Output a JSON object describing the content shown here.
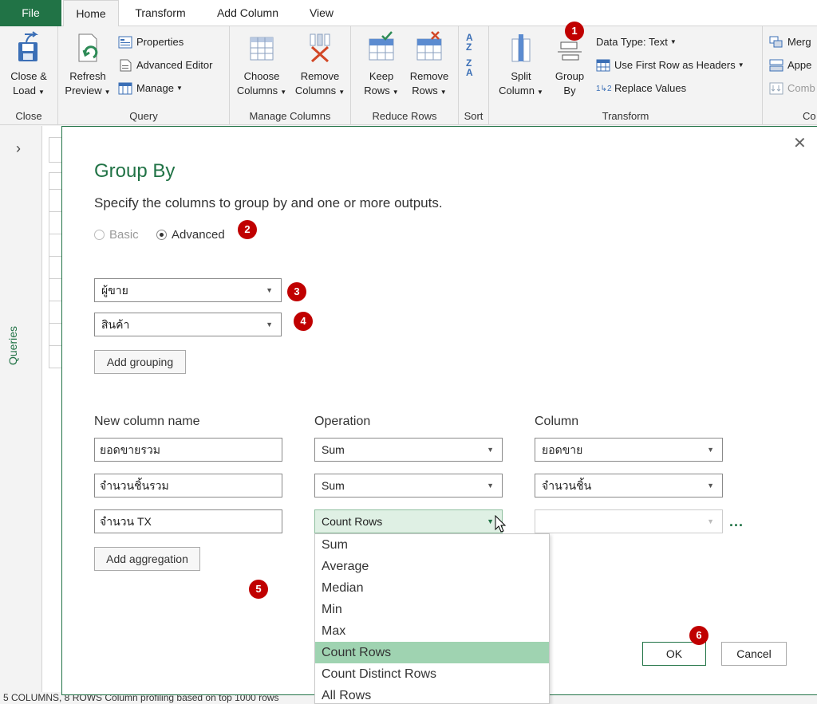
{
  "tabs": [
    {
      "label": "File"
    },
    {
      "label": "Home"
    },
    {
      "label": "Transform"
    },
    {
      "label": "Add Column"
    },
    {
      "label": "View"
    }
  ],
  "ribbon": {
    "close_group": {
      "label": "Close",
      "close_load_l1": "Close &",
      "close_load_l2": "Load"
    },
    "query_group": {
      "label": "Query",
      "refresh_l1": "Refresh",
      "refresh_l2": "Preview",
      "properties": "Properties",
      "advanced_editor": "Advanced Editor",
      "manage": "Manage"
    },
    "manage_columns_group": {
      "label": "Manage Columns",
      "choose_l1": "Choose",
      "choose_l2": "Columns",
      "remove_l1": "Remove",
      "remove_l2": "Columns"
    },
    "reduce_rows_group": {
      "label": "Reduce Rows",
      "keep_l1": "Keep",
      "keep_l2": "Rows",
      "remove_l1": "Remove",
      "remove_l2": "Rows"
    },
    "sort_group": {
      "label": "Sort"
    },
    "transform_group": {
      "label": "Transform",
      "split_l1": "Split",
      "split_l2": "Column",
      "group_l1": "Group",
      "group_l2": "By",
      "data_type": "Data Type: Text",
      "first_row": "Use First Row as Headers",
      "replace": "Replace Values"
    },
    "combine_group": {
      "merge": "Merg",
      "append": "Appe",
      "combine": "Comb",
      "label": "Co"
    }
  },
  "sidebar": {
    "queries_label": "Queries"
  },
  "dialog": {
    "title": "Group By",
    "subtitle": "Specify the columns to group by and one or more outputs.",
    "mode_basic": "Basic",
    "mode_advanced": "Advanced",
    "grouping": [
      "ผู้ขาย",
      "สินค้า"
    ],
    "add_grouping": "Add grouping",
    "headers": {
      "new_column": "New column name",
      "operation": "Operation",
      "column": "Column"
    },
    "aggregations": [
      {
        "name": "ยอดขายรวม",
        "operation": "Sum",
        "column": "ยอดขาย"
      },
      {
        "name": "จำนวนชิ้นรวม",
        "operation": "Sum",
        "column": "จำนวนชิ้น"
      },
      {
        "name": "จำนวน TX",
        "operation": "Count Rows",
        "column": ""
      }
    ],
    "more": "...",
    "add_aggregation": "Add aggregation",
    "operation_options": [
      "Sum",
      "Average",
      "Median",
      "Min",
      "Max",
      "Count Rows",
      "Count Distinct Rows",
      "All Rows"
    ],
    "selected_option": "Count Rows",
    "ok": "OK",
    "cancel": "Cancel"
  },
  "badges": [
    "1",
    "2",
    "3",
    "4",
    "5",
    "6"
  ],
  "status": {
    "text": "5 COLUMNS, 8 ROWS    Column profiling based on top 1000 rows"
  },
  "colors": {
    "accent": "#217346",
    "badge": "#c00000",
    "selected": "#9fd3b1"
  }
}
